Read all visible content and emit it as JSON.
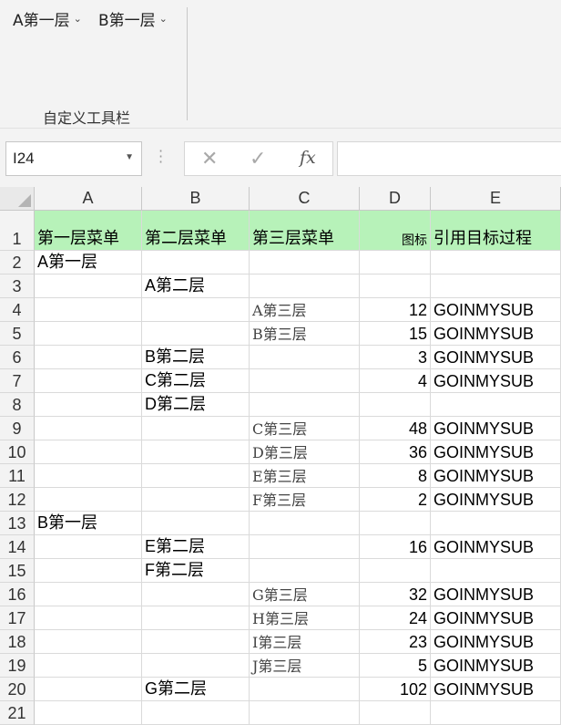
{
  "ribbon": {
    "button1": "A第一层",
    "button2": "B第一层",
    "group_label": "自定义工具栏"
  },
  "formula_bar": {
    "name_box": "I24",
    "fx_label": "fx",
    "formula": ""
  },
  "columns": [
    "A",
    "B",
    "C",
    "D",
    "E"
  ],
  "rows": [
    {
      "num": "1",
      "A": "第一层菜单",
      "B": "第二层菜单",
      "C": "第三层菜单",
      "D": "图标",
      "E": "引用目标过程"
    },
    {
      "num": "2",
      "A": "A第一层",
      "B": "",
      "C": "",
      "D": "",
      "E": ""
    },
    {
      "num": "3",
      "A": "",
      "B": "A第二层",
      "C": "",
      "D": "",
      "E": ""
    },
    {
      "num": "4",
      "A": "",
      "B": "",
      "C": "A第三层",
      "D": "12",
      "E": "GOINMYSUB"
    },
    {
      "num": "5",
      "A": "",
      "B": "",
      "C": "B第三层",
      "D": "15",
      "E": "GOINMYSUB"
    },
    {
      "num": "6",
      "A": "",
      "B": "B第二层",
      "C": "",
      "D": "3",
      "E": "GOINMYSUB"
    },
    {
      "num": "7",
      "A": "",
      "B": "C第二层",
      "C": "",
      "D": "4",
      "E": "GOINMYSUB"
    },
    {
      "num": "8",
      "A": "",
      "B": "D第二层",
      "C": "",
      "D": "",
      "E": ""
    },
    {
      "num": "9",
      "A": "",
      "B": "",
      "C": "C第三层",
      "D": "48",
      "E": "GOINMYSUB"
    },
    {
      "num": "10",
      "A": "",
      "B": "",
      "C": "D第三层",
      "D": "36",
      "E": "GOINMYSUB"
    },
    {
      "num": "11",
      "A": "",
      "B": "",
      "C": "E第三层",
      "D": "8",
      "E": "GOINMYSUB"
    },
    {
      "num": "12",
      "A": "",
      "B": "",
      "C": "F第三层",
      "D": "2",
      "E": "GOINMYSUB"
    },
    {
      "num": "13",
      "A": "B第一层",
      "B": "",
      "C": "",
      "D": "",
      "E": ""
    },
    {
      "num": "14",
      "A": "",
      "B": "E第二层",
      "C": "",
      "D": "16",
      "E": "GOINMYSUB"
    },
    {
      "num": "15",
      "A": "",
      "B": "F第二层",
      "C": "",
      "D": "",
      "E": ""
    },
    {
      "num": "16",
      "A": "",
      "B": "",
      "C": "G第三层",
      "D": "32",
      "E": "GOINMYSUB"
    },
    {
      "num": "17",
      "A": "",
      "B": "",
      "C": "H第三层",
      "D": "24",
      "E": "GOINMYSUB"
    },
    {
      "num": "18",
      "A": "",
      "B": "",
      "C": "I第三层",
      "D": "23",
      "E": "GOINMYSUB"
    },
    {
      "num": "19",
      "A": "",
      "B": "",
      "C": "J第三层",
      "D": "5",
      "E": "GOINMYSUB"
    },
    {
      "num": "20",
      "A": "",
      "B": "G第二层",
      "C": "",
      "D": "102",
      "E": "GOINMYSUB"
    },
    {
      "num": "21",
      "A": "",
      "B": "",
      "C": "",
      "D": "",
      "E": ""
    }
  ],
  "colors": {
    "header_fill": "#b7f2b9",
    "ribbon_bg": "#f3f3f3"
  }
}
